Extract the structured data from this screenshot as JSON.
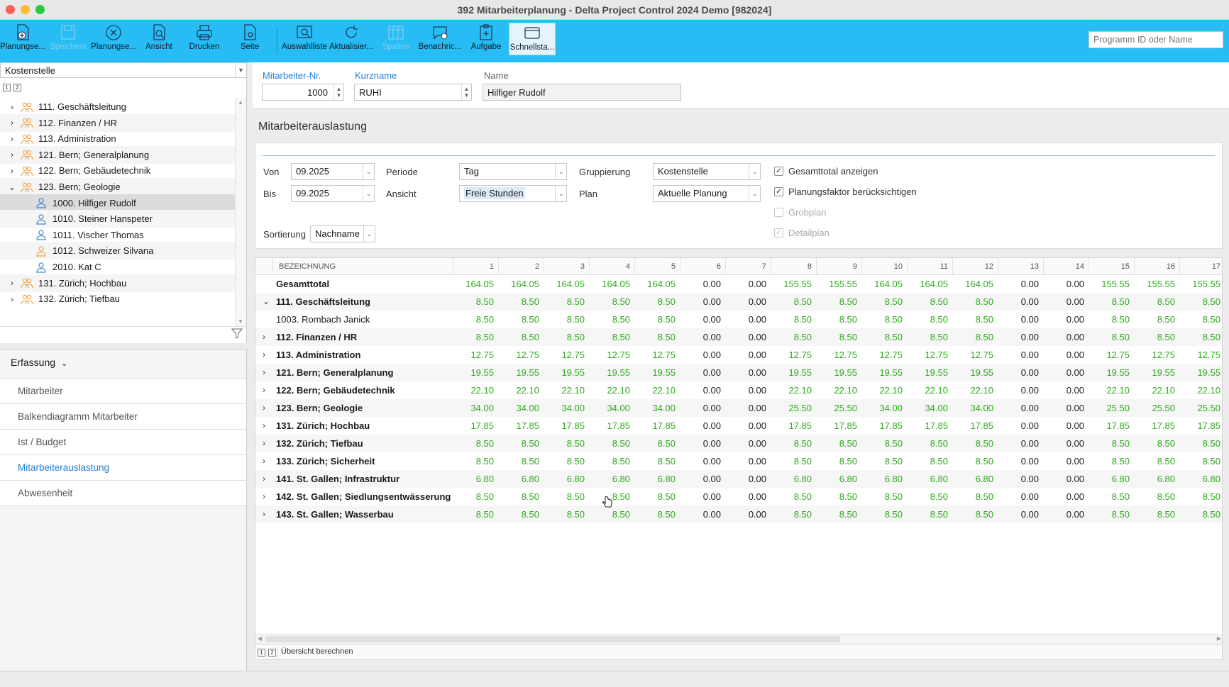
{
  "window": {
    "title": "392 Mitarbeiterplanung - Delta Project Control 2024 Demo [982024]"
  },
  "toolbar": {
    "buttons": [
      {
        "label": "Planungse...",
        "icon": "doc-add-icon",
        "disabled": false
      },
      {
        "label": "Speichern",
        "icon": "save-icon",
        "disabled": true
      },
      {
        "label": "Planungse...",
        "icon": "close-circle-icon",
        "disabled": false
      },
      {
        "label": "Ansicht",
        "icon": "doc-search-icon",
        "disabled": false
      },
      {
        "label": "Drucken",
        "icon": "printer-icon",
        "disabled": false
      },
      {
        "label": "Seite",
        "icon": "page-settings-icon",
        "disabled": false
      },
      {
        "label": "Auswahlliste",
        "icon": "list-search-icon",
        "disabled": false
      },
      {
        "label": "Aktualisier...",
        "icon": "refresh-icon",
        "disabled": false
      },
      {
        "label": "Spalten",
        "icon": "columns-icon",
        "disabled": true
      },
      {
        "label": "Benachric...",
        "icon": "message-add-icon",
        "disabled": false
      },
      {
        "label": "Aufgabe",
        "icon": "task-add-icon",
        "disabled": false
      },
      {
        "label": "Schnellsta...",
        "icon": "window-icon",
        "disabled": false
      }
    ],
    "program_search_placeholder": "Programm ID oder Name"
  },
  "tree": {
    "group_by": "Kostenstelle",
    "tabs": [
      "1",
      "2"
    ],
    "items": [
      {
        "label": "111. Geschäftsleitung",
        "type": "group",
        "expanded": false
      },
      {
        "label": "112. Finanzen / HR",
        "type": "group",
        "expanded": false
      },
      {
        "label": "113. Administration",
        "type": "group",
        "expanded": false
      },
      {
        "label": "121. Bern; Generalplanung",
        "type": "group",
        "expanded": false
      },
      {
        "label": "122. Bern; Gebäudetechnik",
        "type": "group",
        "expanded": false
      },
      {
        "label": "123. Bern; Geologie",
        "type": "group",
        "expanded": true
      },
      {
        "label": "1000. Hilfiger Rudolf",
        "type": "person",
        "selected": true
      },
      {
        "label": "1010. Steiner Hanspeter",
        "type": "person"
      },
      {
        "label": "1011. Vischer Thomas",
        "type": "person"
      },
      {
        "label": "1012. Schweizer Silvana",
        "type": "person-orange"
      },
      {
        "label": "2010. Kat C",
        "type": "person"
      },
      {
        "label": "131. Zürich; Hochbau",
        "type": "group",
        "expanded": false
      },
      {
        "label": "132. Zürich; Tiefbau",
        "type": "group",
        "expanded": false
      }
    ]
  },
  "nav": {
    "header": "Erfassung",
    "items": [
      "Mitarbeiter",
      "Balkendiagramm Mitarbeiter",
      "Ist / Budget",
      "Mitarbeiterauslastung",
      "Abwesenheit"
    ],
    "active_index": 3
  },
  "employee": {
    "nr_label": "Mitarbeiter-Nr.",
    "nr_value": "1000",
    "short_label": "Kurzname",
    "short_value": "RUHI",
    "name_label": "Name",
    "name_value": "Hilfiger Rudolf"
  },
  "section_title": "Mitarbeiterauslastung",
  "filters": {
    "von_label": "Von",
    "von_value": "09.2025",
    "bis_label": "Bis",
    "bis_value": "09.2025",
    "periode_label": "Periode",
    "periode_value": "Tag",
    "ansicht_label": "Ansicht",
    "ansicht_value": "Freie Stunden",
    "gruppierung_label": "Gruppierung",
    "gruppierung_value": "Kostenstelle",
    "plan_label": "Plan",
    "plan_value": "Aktuelle Planung",
    "sortierung_label": "Sortierung",
    "sortierung_value": "Nachname",
    "checkboxes": [
      {
        "label": "Gesamttotal anzeigen",
        "checked": true,
        "disabled": false
      },
      {
        "label": "Planungsfaktor berücksichtigen",
        "checked": true,
        "disabled": false
      },
      {
        "label": "Grobplan",
        "checked": false,
        "disabled": true
      },
      {
        "label": "Detailplan",
        "checked": true,
        "disabled": true
      }
    ]
  },
  "grid": {
    "name_header": "BEZEICHNUNG",
    "columns": [
      "1",
      "2",
      "3",
      "4",
      "5",
      "6",
      "7",
      "8",
      "9",
      "10",
      "11",
      "12",
      "13",
      "14",
      "15",
      "16",
      "17"
    ],
    "rows": [
      {
        "name": "Gesamttotal",
        "bold": true,
        "chev": "",
        "values": [
          "164.05",
          "164.05",
          "164.05",
          "164.05",
          "164.05",
          "0.00",
          "0.00",
          "155.55",
          "155.55",
          "164.05",
          "164.05",
          "164.05",
          "0.00",
          "0.00",
          "155.55",
          "155.55",
          "155.55"
        ]
      },
      {
        "name": "111. Geschäftsleitung",
        "bold": true,
        "chev": "⌄",
        "values": [
          "8.50",
          "8.50",
          "8.50",
          "8.50",
          "8.50",
          "0.00",
          "0.00",
          "8.50",
          "8.50",
          "8.50",
          "8.50",
          "8.50",
          "0.00",
          "0.00",
          "8.50",
          "8.50",
          "8.50"
        ]
      },
      {
        "name": "1003. Rombach Janick",
        "bold": false,
        "chev": "",
        "values": [
          "8.50",
          "8.50",
          "8.50",
          "8.50",
          "8.50",
          "0.00",
          "0.00",
          "8.50",
          "8.50",
          "8.50",
          "8.50",
          "8.50",
          "0.00",
          "0.00",
          "8.50",
          "8.50",
          "8.50"
        ]
      },
      {
        "name": "112. Finanzen / HR",
        "bold": true,
        "chev": "›",
        "values": [
          "8.50",
          "8.50",
          "8.50",
          "8.50",
          "8.50",
          "0.00",
          "0.00",
          "8.50",
          "8.50",
          "8.50",
          "8.50",
          "8.50",
          "0.00",
          "0.00",
          "8.50",
          "8.50",
          "8.50"
        ]
      },
      {
        "name": "113. Administration",
        "bold": true,
        "chev": "›",
        "values": [
          "12.75",
          "12.75",
          "12.75",
          "12.75",
          "12.75",
          "0.00",
          "0.00",
          "12.75",
          "12.75",
          "12.75",
          "12.75",
          "12.75",
          "0.00",
          "0.00",
          "12.75",
          "12.75",
          "12.75"
        ]
      },
      {
        "name": "121. Bern; Generalplanung",
        "bold": true,
        "chev": "›",
        "values": [
          "19.55",
          "19.55",
          "19.55",
          "19.55",
          "19.55",
          "0.00",
          "0.00",
          "19.55",
          "19.55",
          "19.55",
          "19.55",
          "19.55",
          "0.00",
          "0.00",
          "19.55",
          "19.55",
          "19.55"
        ]
      },
      {
        "name": "122. Bern; Gebäudetechnik",
        "bold": true,
        "chev": "›",
        "values": [
          "22.10",
          "22.10",
          "22.10",
          "22.10",
          "22.10",
          "0.00",
          "0.00",
          "22.10",
          "22.10",
          "22.10",
          "22.10",
          "22.10",
          "0.00",
          "0.00",
          "22.10",
          "22.10",
          "22.10"
        ]
      },
      {
        "name": "123. Bern; Geologie",
        "bold": true,
        "chev": "›",
        "values": [
          "34.00",
          "34.00",
          "34.00",
          "34.00",
          "34.00",
          "0.00",
          "0.00",
          "25.50",
          "25.50",
          "34.00",
          "34.00",
          "34.00",
          "0.00",
          "0.00",
          "25.50",
          "25.50",
          "25.50"
        ]
      },
      {
        "name": "131. Zürich; Hochbau",
        "bold": true,
        "chev": "›",
        "values": [
          "17.85",
          "17.85",
          "17.85",
          "17.85",
          "17.85",
          "0.00",
          "0.00",
          "17.85",
          "17.85",
          "17.85",
          "17.85",
          "17.85",
          "0.00",
          "0.00",
          "17.85",
          "17.85",
          "17.85"
        ]
      },
      {
        "name": "132. Zürich; Tiefbau",
        "bold": true,
        "chev": "›",
        "values": [
          "8.50",
          "8.50",
          "8.50",
          "8.50",
          "8.50",
          "0.00",
          "0.00",
          "8.50",
          "8.50",
          "8.50",
          "8.50",
          "8.50",
          "0.00",
          "0.00",
          "8.50",
          "8.50",
          "8.50"
        ]
      },
      {
        "name": "133. Zürich; Sicherheit",
        "bold": true,
        "chev": "›",
        "values": [
          "8.50",
          "8.50",
          "8.50",
          "8.50",
          "8.50",
          "0.00",
          "0.00",
          "8.50",
          "8.50",
          "8.50",
          "8.50",
          "8.50",
          "0.00",
          "0.00",
          "8.50",
          "8.50",
          "8.50"
        ]
      },
      {
        "name": "141. St. Gallen; Infrastruktur",
        "bold": true,
        "chev": "›",
        "values": [
          "6.80",
          "6.80",
          "6.80",
          "6.80",
          "6.80",
          "0.00",
          "0.00",
          "6.80",
          "6.80",
          "6.80",
          "6.80",
          "6.80",
          "0.00",
          "0.00",
          "6.80",
          "6.80",
          "6.80"
        ]
      },
      {
        "name": "142. St. Gallen; Siedlungsentwässerung",
        "bold": true,
        "chev": "›",
        "values": [
          "8.50",
          "8.50",
          "8.50",
          "8.50",
          "8.50",
          "0.00",
          "0.00",
          "8.50",
          "8.50",
          "8.50",
          "8.50",
          "8.50",
          "0.00",
          "0.00",
          "8.50",
          "8.50",
          "8.50"
        ]
      },
      {
        "name": "143. St. Gallen; Wasserbau",
        "bold": true,
        "chev": "›",
        "values": [
          "8.50",
          "8.50",
          "8.50",
          "8.50",
          "8.50",
          "0.00",
          "0.00",
          "8.50",
          "8.50",
          "8.50",
          "8.50",
          "8.50",
          "0.00",
          "0.00",
          "8.50",
          "8.50",
          "8.50"
        ]
      }
    ],
    "colors": {
      "positive": "#2eaa1c",
      "zero": "#222222"
    }
  },
  "bottom": {
    "tabs": [
      "1",
      "2"
    ],
    "label": "Übersicht berechnen"
  }
}
